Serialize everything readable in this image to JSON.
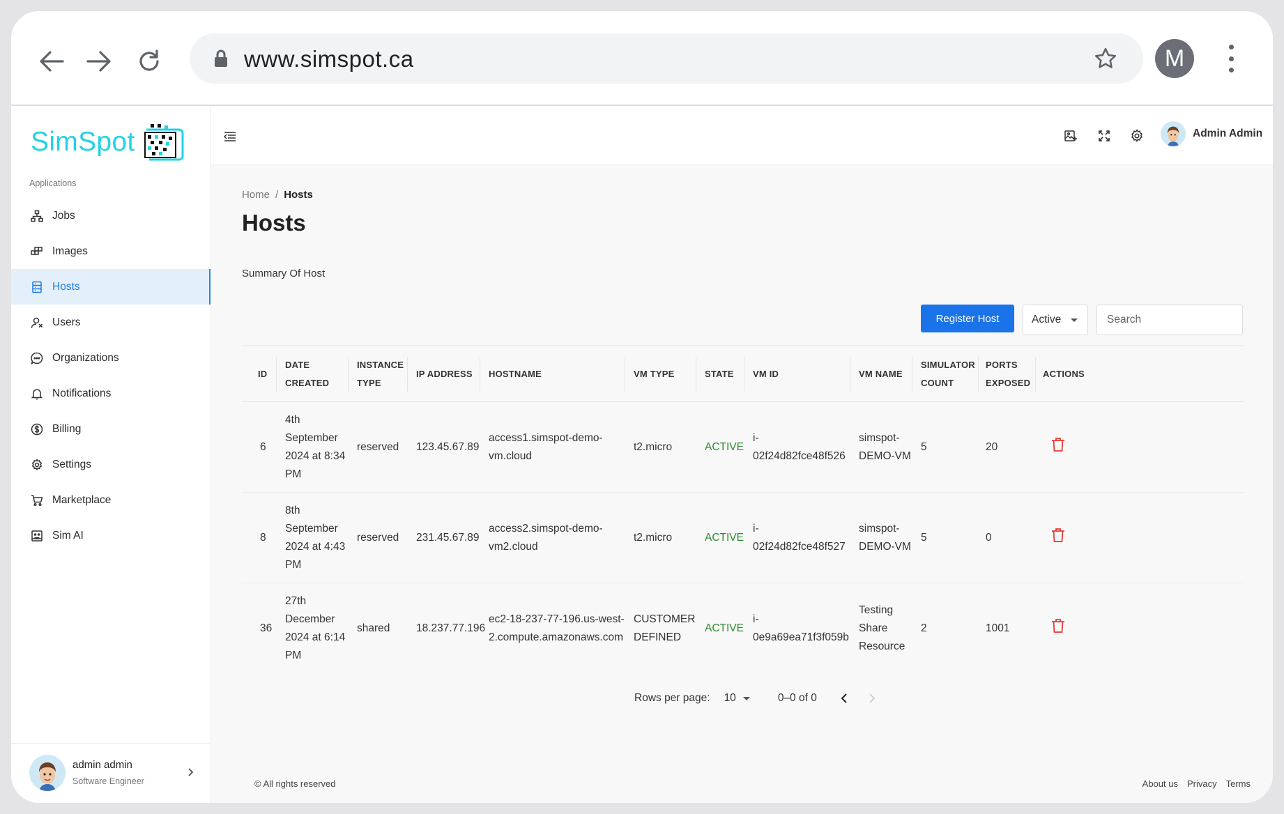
{
  "browser": {
    "url": "www.simspot.ca",
    "profile_initial": "M",
    "icons": [
      "back-arrow-icon",
      "forward-arrow-icon",
      "reload-icon",
      "lock-icon",
      "star-icon",
      "kebab-menu-icon"
    ]
  },
  "brand": {
    "logo_text": "SimSpot",
    "accent": "#22d3e6"
  },
  "sidebar": {
    "section_label": "Applications",
    "items": [
      {
        "label": "Jobs",
        "icon": "hierarchy-icon"
      },
      {
        "label": "Images",
        "icon": "blocks-icon"
      },
      {
        "label": "Hosts",
        "icon": "server-icon",
        "active": true
      },
      {
        "label": "Users",
        "icon": "users-icon"
      },
      {
        "label": "Organizations",
        "icon": "chat-icon"
      },
      {
        "label": "Notifications",
        "icon": "bell-icon"
      },
      {
        "label": "Billing",
        "icon": "dollar-icon"
      },
      {
        "label": "Settings",
        "icon": "gear-icon"
      },
      {
        "label": "Marketplace",
        "icon": "cart-icon"
      },
      {
        "label": "Sim AI",
        "icon": "robot-icon"
      }
    ],
    "user": {
      "name": "admin admin",
      "role": "Software Engineer"
    }
  },
  "topbar": {
    "user_name": "Admin Admin"
  },
  "breadcrumb": {
    "home": "Home",
    "separator": "/",
    "current": "Hosts"
  },
  "page": {
    "title": "Hosts",
    "summary": "Summary Of Host",
    "register_label": "Register Host",
    "filter_value": "Active",
    "search_placeholder": "Search"
  },
  "table": {
    "headers": {
      "id": "ID",
      "date": [
        "DATE",
        "CREATED"
      ],
      "instance": [
        "INSTANCE",
        "TYPE"
      ],
      "ip": "IP ADDRESS",
      "hostname": "HOSTNAME",
      "vmtype": "VM TYPE",
      "state": "STATE",
      "vmid": "VM ID",
      "vmname": "VM NAME",
      "sim": [
        "SIMULATOR",
        "COUNT"
      ],
      "ports": [
        "PORTS",
        "EXPOSED"
      ],
      "actions": "ACTIONS"
    },
    "rows": [
      {
        "id": "6",
        "date": [
          "4th",
          "September",
          "2024 at 8:34",
          "PM"
        ],
        "instance": "reserved",
        "ip": "123.45.67.89",
        "hostname": [
          "access1.simspot-demo-",
          "vm.cloud"
        ],
        "vmtype": [
          "t2.micro"
        ],
        "state": "ACTIVE",
        "vmid": [
          "i-",
          "02f24d82fce48f526"
        ],
        "vmname": [
          "simspot-",
          "DEMO-VM"
        ],
        "sim": "5",
        "ports": "20"
      },
      {
        "id": "8",
        "date": [
          "8th",
          "September",
          "2024 at 4:43",
          "PM"
        ],
        "instance": "reserved",
        "ip": "231.45.67.89",
        "hostname": [
          "access2.simspot-demo-",
          "vm2.cloud"
        ],
        "vmtype": [
          "t2.micro"
        ],
        "state": "ACTIVE",
        "vmid": [
          "i-",
          "02f24d82fce48f527"
        ],
        "vmname": [
          "simspot-",
          "DEMO-VM"
        ],
        "sim": "5",
        "ports": "0"
      },
      {
        "id": "36",
        "date": [
          "27th",
          "December",
          "2024 at 6:14",
          "PM"
        ],
        "instance": "shared",
        "ip": "18.237.77.196",
        "hostname": [
          "ec2-18-237-77-196.us-west-",
          "2.compute.amazonaws.com"
        ],
        "vmtype": [
          "CUSTOMER",
          "DEFINED"
        ],
        "state": "ACTIVE",
        "vmid": [
          "i-",
          "0e9a69ea71f3f059b"
        ],
        "vmname": [
          "Testing",
          "Share",
          "Resource"
        ],
        "sim": "2",
        "ports": "1001"
      }
    ],
    "state_color": "#2e8b2e",
    "delete_color": "#e53935"
  },
  "pagination": {
    "rows_label": "Rows per page:",
    "rows_value": "10",
    "range": "0–0 of 0"
  },
  "footer": {
    "copyright": "© All rights reserved",
    "links": [
      "About us",
      "Privacy",
      "Terms"
    ]
  }
}
